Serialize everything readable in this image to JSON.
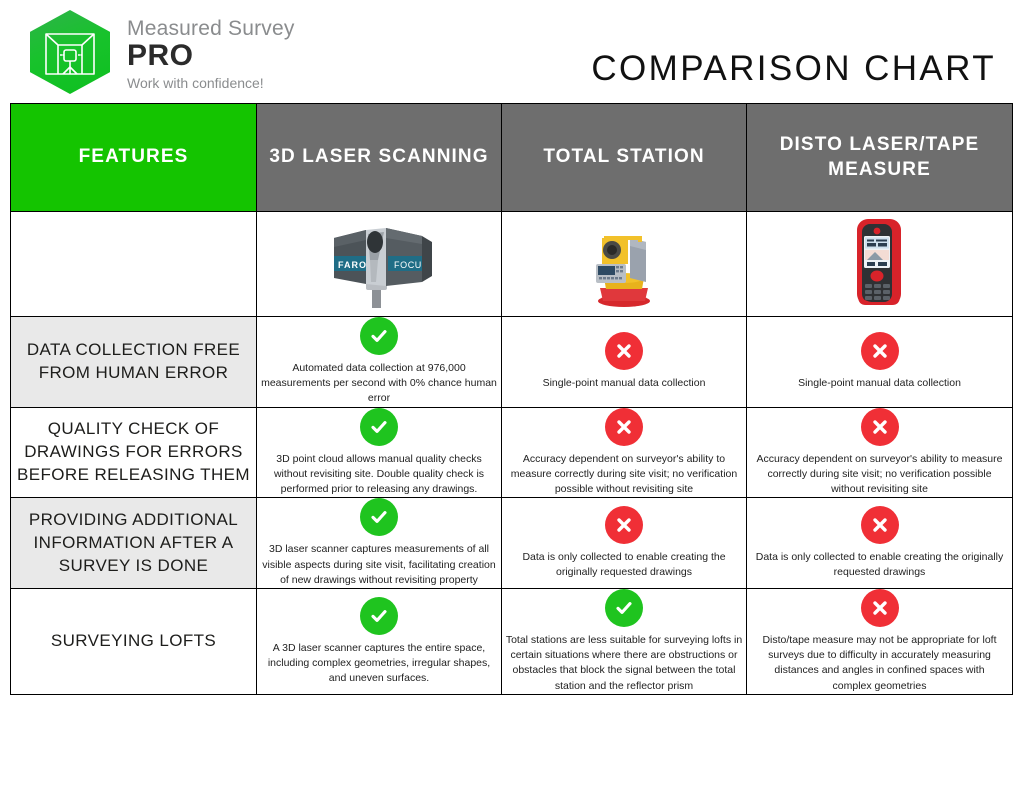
{
  "brand": {
    "name_top": "Measured Survey",
    "name_bottom": "PRO",
    "tagline": "Work with confidence!",
    "logo_icon": "hexagon-room-scanner-icon",
    "green": "#14c400"
  },
  "header": {
    "title": "COMPARISON CHART"
  },
  "table": {
    "columns": [
      {
        "label": "FEATURES",
        "bg": "#14c400"
      },
      {
        "label": "3D LASER SCANNING",
        "bg": "#6e6e6e"
      },
      {
        "label": "TOTAL STATION",
        "bg": "#6e6e6e"
      },
      {
        "label": "DISTO LASER/TAPE MEASURE",
        "bg": "#6e6e6e"
      }
    ],
    "device_images": [
      {
        "icon": "faro-focus-laser-scanner-image",
        "alt": "3D laser scanner"
      },
      {
        "icon": "total-station-image",
        "alt": "Total station"
      },
      {
        "icon": "leica-disto-laser-measure-image",
        "alt": "Disto laser measure"
      }
    ],
    "rows": [
      {
        "feature": "DATA COLLECTION FREE FROM HUMAN ERROR",
        "shaded": true,
        "cells": [
          {
            "status": "yes",
            "text": "Automated data collection at 976,000 measurements per second with 0% chance human error"
          },
          {
            "status": "no",
            "text": "Single-point manual data collection"
          },
          {
            "status": "no",
            "text": "Single-point manual data collection"
          }
        ]
      },
      {
        "feature": "QUALITY CHECK OF DRAWINGS FOR ERRORS BEFORE RELEASING THEM",
        "shaded": false,
        "cells": [
          {
            "status": "yes",
            "text": "3D point cloud allows manual quality checks without revisiting site. Double quality check is performed prior to releasing any drawings."
          },
          {
            "status": "no",
            "text": "Accuracy dependent on surveyor's ability to measure correctly during site visit; no verification possible without revisiting site"
          },
          {
            "status": "no",
            "text": "Accuracy dependent on surveyor's ability to measure correctly during site visit; no verification possible without revisiting site"
          }
        ]
      },
      {
        "feature": "PROVIDING ADDITIONAL INFORMATION AFTER A SURVEY IS DONE",
        "shaded": true,
        "cells": [
          {
            "status": "yes",
            "text": "3D laser scanner captures measurements of all visible aspects during site visit, facilitating creation of new drawings without revisiting property"
          },
          {
            "status": "no",
            "text": "Data is only collected to enable creating the originally requested drawings"
          },
          {
            "status": "no",
            "text": "Data is only collected to enable creating the originally requested drawings"
          }
        ]
      },
      {
        "feature": "SURVEYING LOFTS",
        "shaded": false,
        "cells": [
          {
            "status": "yes",
            "text": "A 3D laser scanner captures the entire space, including complex geometries, irregular shapes, and uneven surfaces."
          },
          {
            "status": "yes",
            "text": "Total stations are less suitable for surveying lofts in certain situations where there are obstructions or obstacles that block the signal between the total station and the reflector prism"
          },
          {
            "status": "no",
            "text": "Disto/tape measure may not be appropriate for loft surveys due to difficulty in accurately measuring distances and angles in confined spaces with complex geometries"
          }
        ]
      }
    ],
    "status_colors": {
      "yes": "#1fc41f",
      "no": "#f02f36"
    },
    "status_icons": {
      "yes": "check-circle-icon",
      "no": "cross-circle-icon"
    }
  }
}
